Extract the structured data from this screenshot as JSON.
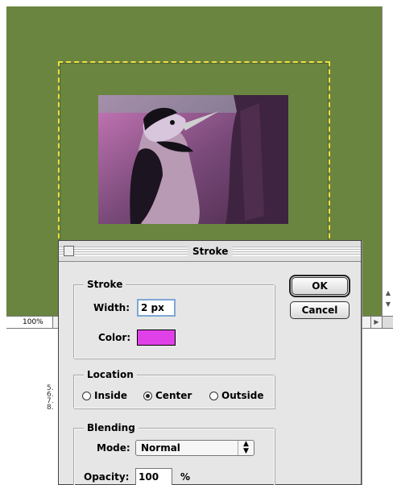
{
  "document": {
    "zoom": "100%",
    "scroll_up_icon": "triangle-up-icon",
    "scroll_down_icon": "triangle-down-icon",
    "scroll_right_icon": "triangle-right-icon"
  },
  "background_list": [
    "5.",
    "6.",
    "7.",
    "8."
  ],
  "dialog": {
    "title": "Stroke",
    "ok_label": "OK",
    "cancel_label": "Cancel",
    "stroke": {
      "group_title": "Stroke",
      "width_label": "Width:",
      "width_value": "2 px",
      "color_label": "Color:",
      "color_value": "#e040e8"
    },
    "location": {
      "group_title": "Location",
      "options": [
        "Inside",
        "Center",
        "Outside"
      ],
      "selected": "Center"
    },
    "blending": {
      "group_title": "Blending",
      "mode_label": "Mode:",
      "mode_value": "Normal",
      "opacity_label": "Opacity:",
      "opacity_value": "100",
      "opacity_unit": "%"
    }
  },
  "colors": {
    "canvas": "#6a8540",
    "selection_marquee": "#f0e040",
    "stroke_color": "#e040e8"
  }
}
